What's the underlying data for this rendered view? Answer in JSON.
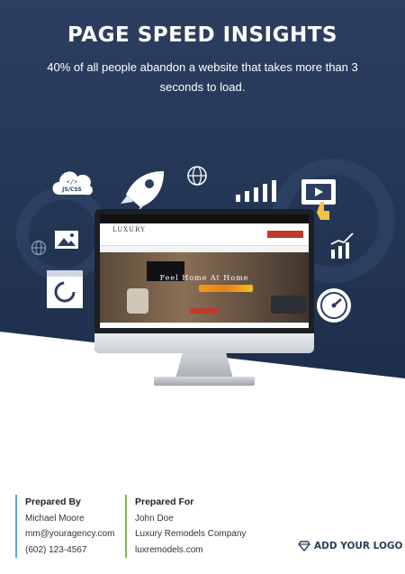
{
  "header": {
    "title": "PAGE SPEED INSIGHTS",
    "subtitle": "40% of all people abandon a website that takes more than 3 seconds to load."
  },
  "icons": [
    "js-css-cloud-icon",
    "rocket-icon",
    "globe-icon",
    "bar-chart-icon",
    "video-player-icon",
    "cursor-hand-icon",
    "image-icon",
    "globe-small-icon",
    "loading-circle-icon",
    "trend-chart-icon",
    "speedometer-icon"
  ],
  "website_preview": {
    "logo": "LUXURY",
    "headline": "Feel Home At Home"
  },
  "prepared_by": {
    "heading": "Prepared By",
    "name": "Michael Moore",
    "email": "mm@youragency.com",
    "phone": "(602) 123-4567"
  },
  "prepared_for": {
    "heading": "Prepared For",
    "name": "John Doe",
    "company": "Luxury Remodels Company",
    "website": "luxremodels.com"
  },
  "logo_placeholder": "ADD YOUR LOGO",
  "colors": {
    "navy": "#24385a",
    "accent_blue": "#5aa9d6",
    "accent_green": "#7dbb4e"
  }
}
